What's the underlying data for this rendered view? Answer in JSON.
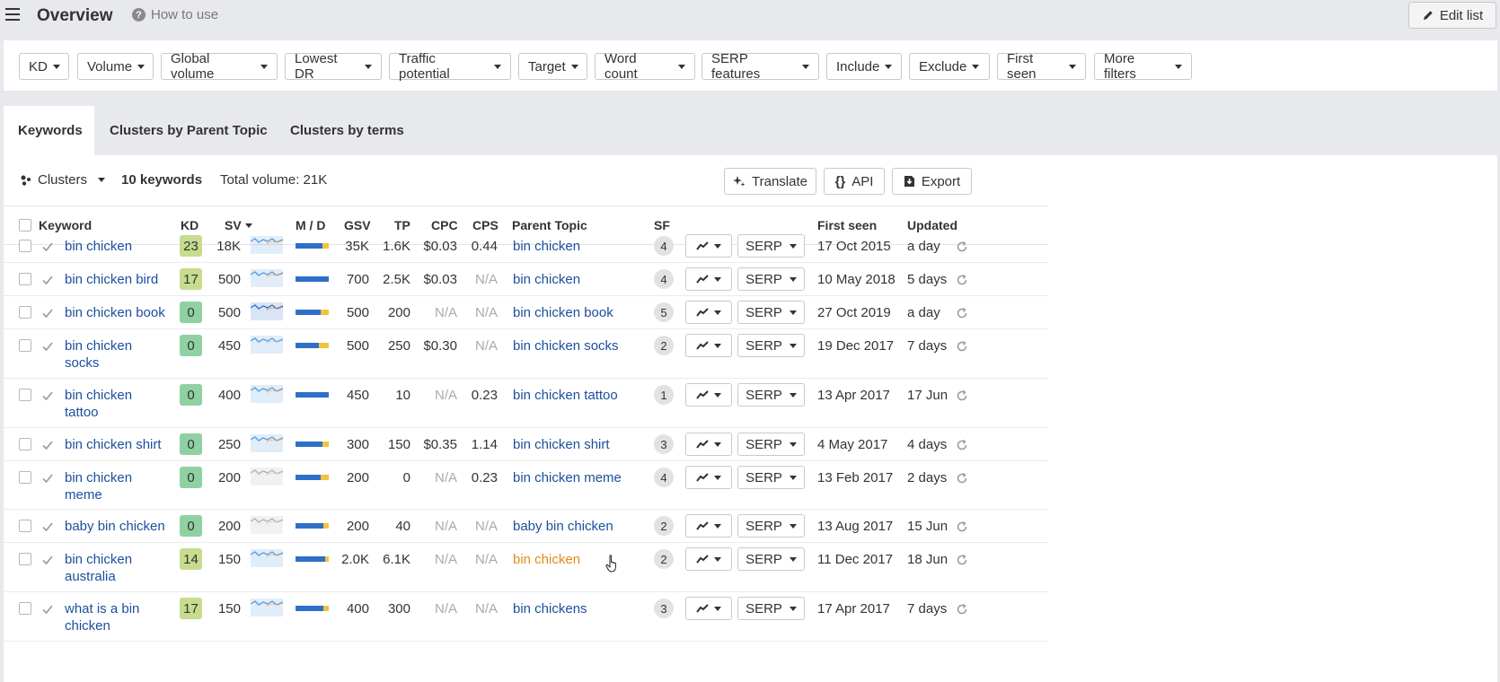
{
  "header": {
    "title": "Overview",
    "how_to_use": "How to use",
    "edit_list": "Edit list"
  },
  "filters": [
    "KD",
    "Volume",
    "Global volume",
    "Lowest DR",
    "Traffic potential",
    "Target",
    "Word count",
    "SERP features",
    "Include",
    "Exclude",
    "First seen",
    "More filters"
  ],
  "tabs": [
    {
      "label": "Keywords",
      "active": true
    },
    {
      "label": "Clusters by Parent Topic",
      "active": false
    },
    {
      "label": "Clusters by terms",
      "active": false
    }
  ],
  "toolbar": {
    "clusters_label": "Clusters",
    "keyword_count": "10 keywords",
    "total_volume": "Total volume: 21K",
    "translate": "Translate",
    "api": "API",
    "export": "Export"
  },
  "columns": {
    "keyword": "Keyword",
    "kd": "KD",
    "sv": "SV",
    "md": "M / D",
    "gsv": "GSV",
    "tp": "TP",
    "cpc": "CPC",
    "cps": "CPS",
    "parent_topic": "Parent Topic",
    "sf": "SF",
    "first_seen": "First seen",
    "updated": "Updated"
  },
  "serp_label": "SERP",
  "colors": {
    "link": "#1b4f9c",
    "link_hover": "#e48a1c",
    "kd_yellowgreen": "#c7dc8f",
    "kd_green": "#8fd1a3",
    "md_blue": "#2f6fca",
    "md_yellow": "#f2c33c"
  },
  "rows": [
    {
      "kw1": "bin chicken",
      "kw2": "",
      "kd": "23",
      "sv": "18K",
      "gsv": "35K",
      "tp": "1.6K",
      "cpc": "$0.03",
      "cps": "0.44",
      "parent": "bin chicken",
      "sf": "4",
      "first_seen": "17 Oct 2015",
      "updated": "a day"
    },
    {
      "kw1": "bin chicken bird",
      "kw2": "",
      "kd": "17",
      "sv": "500",
      "gsv": "700",
      "tp": "2.5K",
      "cpc": "$0.03",
      "cps": "N/A",
      "parent": "bin chicken",
      "sf": "4",
      "first_seen": "10 May 2018",
      "updated": "5 days"
    },
    {
      "kw1": "bin chicken book",
      "kw2": "",
      "kd": "0",
      "sv": "500",
      "gsv": "500",
      "tp": "200",
      "cpc": "N/A",
      "cps": "N/A",
      "parent": "bin chicken book",
      "sf": "5",
      "first_seen": "27 Oct 2019",
      "updated": "a day"
    },
    {
      "kw1": "bin chicken",
      "kw2": "socks",
      "kd": "0",
      "sv": "450",
      "gsv": "500",
      "tp": "250",
      "cpc": "$0.30",
      "cps": "N/A",
      "parent": "bin chicken socks",
      "sf": "2",
      "first_seen": "19 Dec 2017",
      "updated": "7 days"
    },
    {
      "kw1": "bin chicken",
      "kw2": "tattoo",
      "kd": "0",
      "sv": "400",
      "gsv": "450",
      "tp": "10",
      "cpc": "N/A",
      "cps": "0.23",
      "parent": "bin chicken tattoo",
      "sf": "1",
      "first_seen": "13 Apr 2017",
      "updated": "17 Jun"
    },
    {
      "kw1": "bin chicken shirt",
      "kw2": "",
      "kd": "0",
      "sv": "250",
      "gsv": "300",
      "tp": "150",
      "cpc": "$0.35",
      "cps": "1.14",
      "parent": "bin chicken shirt",
      "sf": "3",
      "first_seen": "4 May 2017",
      "updated": "4 days"
    },
    {
      "kw1": "bin chicken",
      "kw2": "meme",
      "kd": "0",
      "sv": "200",
      "gsv": "200",
      "tp": "0",
      "cpc": "N/A",
      "cps": "0.23",
      "parent": "bin chicken meme",
      "sf": "4",
      "first_seen": "13 Feb 2017",
      "updated": "2 days"
    },
    {
      "kw1": "baby bin chicken",
      "kw2": "",
      "kd": "0",
      "sv": "200",
      "gsv": "200",
      "tp": "40",
      "cpc": "N/A",
      "cps": "N/A",
      "parent": "baby bin chicken",
      "sf": "2",
      "first_seen": "13 Aug 2017",
      "updated": "15 Jun"
    },
    {
      "kw1": "bin chicken",
      "kw2": "australia",
      "kd": "14",
      "sv": "150",
      "gsv": "2.0K",
      "tp": "6.1K",
      "cpc": "N/A",
      "cps": "N/A",
      "parent": "bin chicken",
      "sf": "2",
      "first_seen": "11 Dec 2017",
      "updated": "18 Jun"
    },
    {
      "kw1": "what is a bin",
      "kw2": "chicken",
      "kd": "17",
      "sv": "150",
      "gsv": "400",
      "tp": "300",
      "cpc": "N/A",
      "cps": "N/A",
      "parent": "bin chickens",
      "sf": "3",
      "first_seen": "17 Apr 2017",
      "updated": "7 days"
    }
  ]
}
